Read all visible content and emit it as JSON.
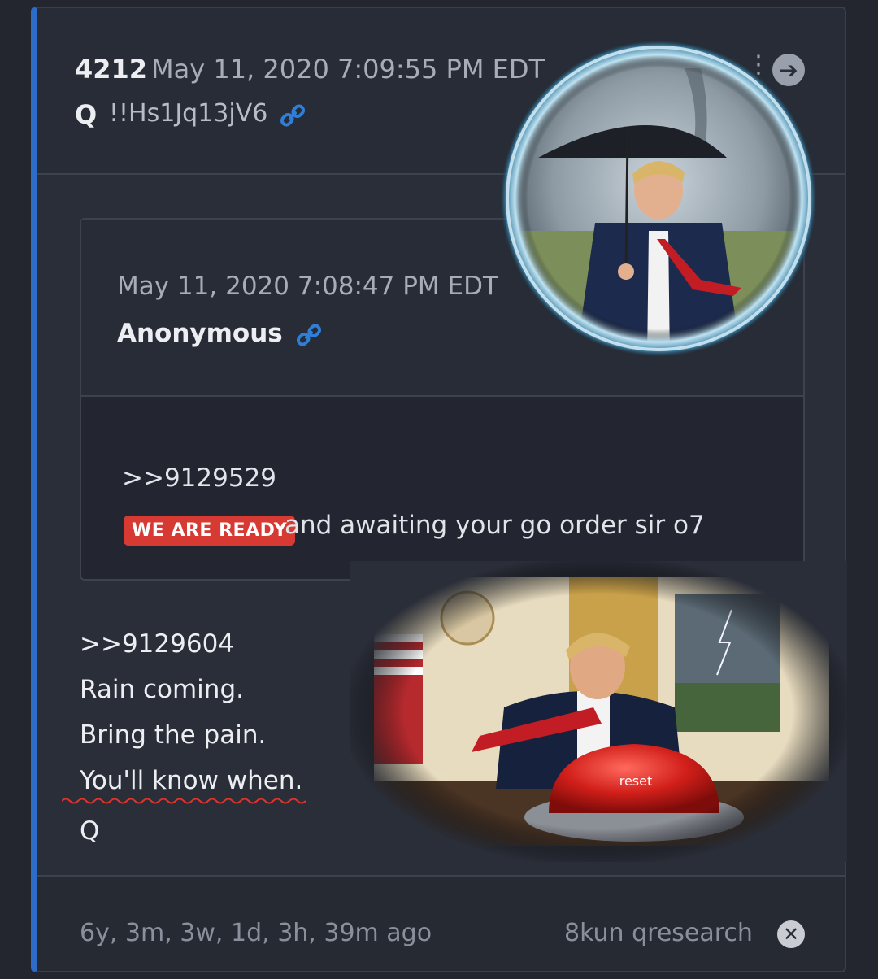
{
  "post": {
    "number": "4212",
    "date": "May 11, 2020 7:09:55 PM EDT",
    "author": "Q",
    "tripcode": "!!Hs1Jq13jV6",
    "link_icon": "link-icon",
    "nav_icon": "arrow-right-circle-icon",
    "nav_symbol": "➔",
    "menu_symbol": "⋮"
  },
  "quoted": {
    "date": "May 11, 2020 7:08:47 PM EDT",
    "author": "Anonymous",
    "reference": ">>9129529",
    "badge": "WE ARE READY",
    "body": "and awaiting your go order sir o7"
  },
  "reply": {
    "reference": ">>9129604",
    "lines": [
      "Rain coming.",
      "Bring the pain.",
      "You'll know when."
    ],
    "signature": "Q"
  },
  "images": {
    "top": "circular-storm-umbrella-photo",
    "bottom": "oval-office-reset-button-photo",
    "button_label": "reset"
  },
  "footer": {
    "age": "6y, 3m, 3w, 1d, 3h, 39m ago",
    "source": "8kun qresearch",
    "close_symbol": "✕"
  },
  "colors": {
    "accent": "#2d6cc9",
    "badge": "#d63a33",
    "link": "#2f7fd8",
    "background": "#2a2e38"
  }
}
